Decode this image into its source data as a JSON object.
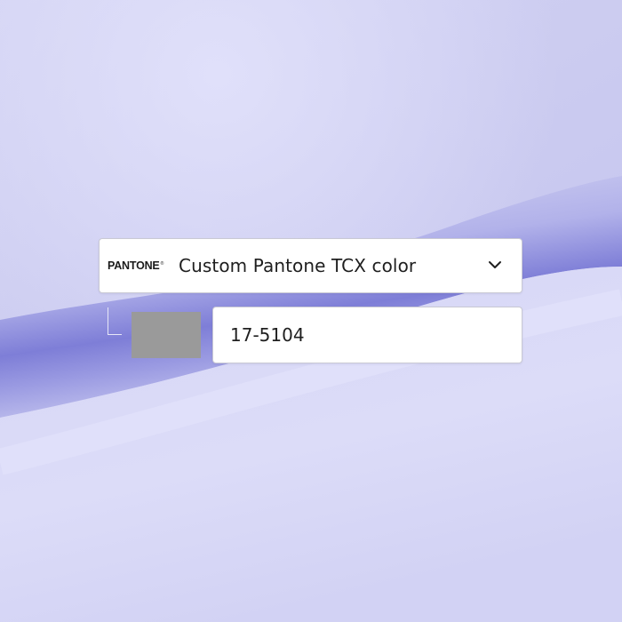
{
  "colors": {
    "fabric_base": "#cdcdf2",
    "fabric_highlight": "#e0e0fa",
    "fabric_shadow": "#7f7fd6",
    "swatch": "#9a9a9a",
    "field_background": "#ffffff",
    "field_border": "#c9c9d4",
    "text": "#1f1f1f"
  },
  "color_selector": {
    "brand_logo": "PANTONE",
    "brand_logo_mark": "®",
    "selected_option": "Custom Pantone TCX color",
    "dropdown_icon": "chevron-down-icon"
  },
  "color_code": {
    "value": "17-5104"
  }
}
